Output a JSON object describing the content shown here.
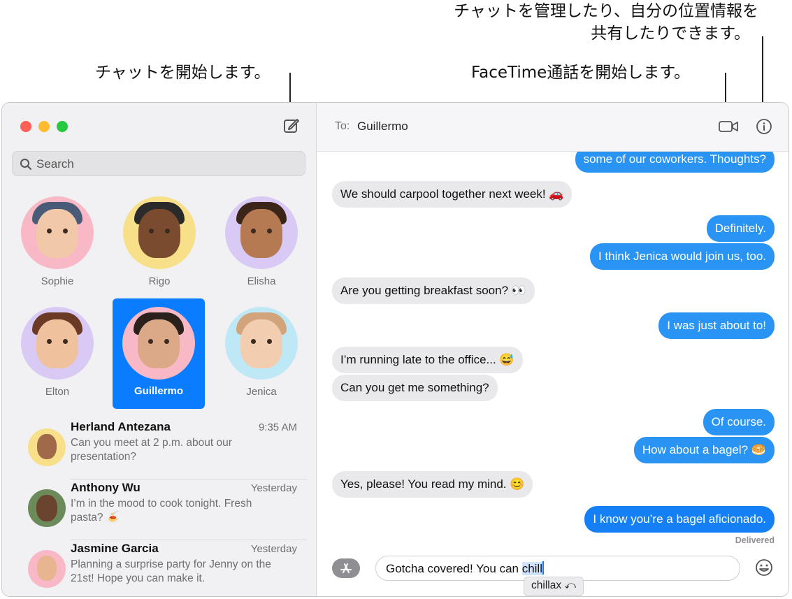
{
  "callouts": {
    "manage_line1": "チャットを管理したり、自分の位置情報を",
    "manage_line2": "共有したりできます。",
    "start_chat": "チャットを開始します。",
    "facetime": "FaceTime通話を開始します。"
  },
  "sidebar": {
    "search_placeholder": "Search",
    "pinned": [
      {
        "name": "Sophie"
      },
      {
        "name": "Rigo"
      },
      {
        "name": "Elisha"
      },
      {
        "name": "Elton"
      },
      {
        "name": "Guillermo",
        "selected": true
      },
      {
        "name": "Jenica"
      }
    ],
    "conversations": [
      {
        "name": "Herland Antezana",
        "time": "9:35 AM",
        "preview": "Can you meet at 2 p.m. about our presentation?"
      },
      {
        "name": "Anthony Wu",
        "time": "Yesterday",
        "preview": "I’m in the mood to cook tonight. Fresh pasta? 🍝"
      },
      {
        "name": "Jasmine Garcia",
        "time": "Yesterday",
        "preview": "Planning a surprise party for Jenny on the 21st! Hope you can make it."
      }
    ]
  },
  "header": {
    "to_label": "To:",
    "recipient": "Guillermo"
  },
  "messages": [
    {
      "dir": "out",
      "text": "some of our coworkers. Thoughts?"
    },
    {
      "dir": "in",
      "text": "We should carpool together next week! 🚗"
    },
    {
      "dir": "out",
      "text": "Definitely."
    },
    {
      "dir": "out",
      "text": "I think Jenica would join us, too."
    },
    {
      "dir": "in",
      "text": "Are you getting breakfast soon? 👀"
    },
    {
      "dir": "out",
      "text": "I was just about to!"
    },
    {
      "dir": "in",
      "text": "I’m running late to the office... 😅"
    },
    {
      "dir": "in",
      "text": "Can you get me something?"
    },
    {
      "dir": "out",
      "text": "Of course."
    },
    {
      "dir": "out",
      "text": "How about a bagel? 🥯"
    },
    {
      "dir": "in",
      "text": "Yes, please! You read my mind. 😊"
    },
    {
      "dir": "out",
      "text": "I know you’re a bagel aficionado."
    }
  ],
  "status": "Delivered",
  "composer": {
    "text_before": "Gotcha covered! You can ",
    "highlighted": "chill",
    "suggestion": "chillax ⤺"
  },
  "colors": {
    "accent": "#0a7cff",
    "outgoing_bubble": "#2a94f4",
    "incoming_bubble": "#e9e9eb"
  },
  "icons": [
    "compose-icon",
    "search-icon",
    "video-icon",
    "info-icon",
    "app-store-icon",
    "emoji-icon"
  ]
}
